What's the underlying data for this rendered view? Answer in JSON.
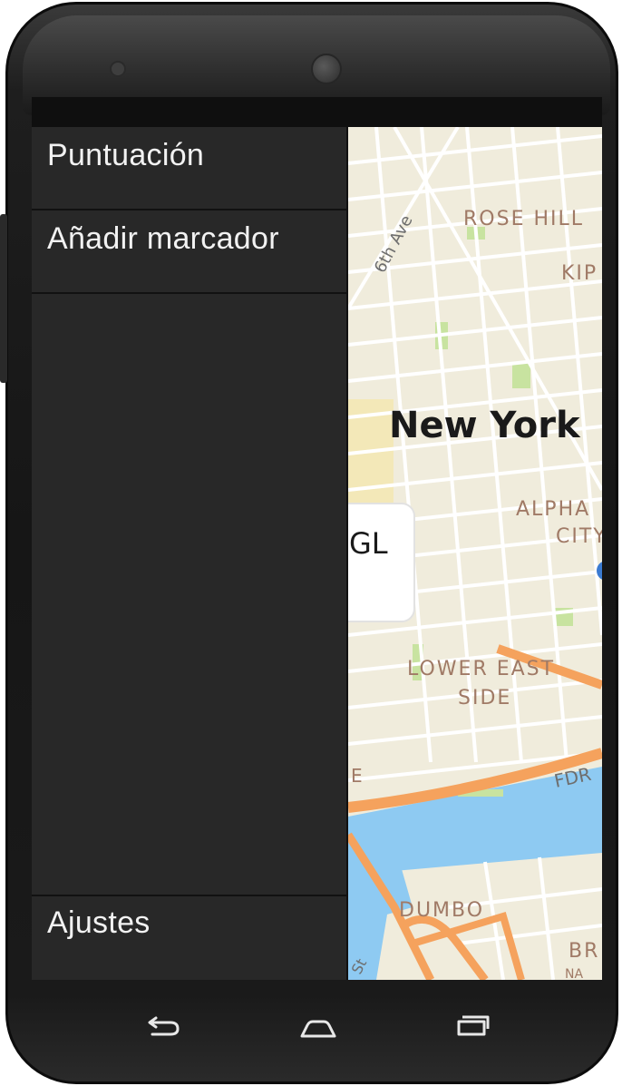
{
  "drawer": {
    "items": [
      {
        "label": "Puntuación"
      },
      {
        "label": "Añadir marcador"
      }
    ],
    "bottom_item": {
      "label": "Ajustes"
    }
  },
  "map": {
    "labels": {
      "rose_hill": "ROSE HILL",
      "kip": "KIP",
      "sixth_ave": "6th Ave",
      "new_york": "New York",
      "alpha": "ALPHA",
      "city": "CITY",
      "lower_east": "LOWER EAST",
      "side": "SIDE",
      "fdr": "FDR",
      "dumbo": "DUMBO",
      "br": "BR",
      "st": "St",
      "na": "NA",
      "e": "E"
    },
    "popup_text": "GL"
  },
  "colors": {
    "drawer_bg": "#282828",
    "map_land": "#f0ecdc",
    "water": "#8ecaf2",
    "highway": "#f5a25d",
    "park": "#c8e3a0"
  },
  "navbar": {
    "icons": [
      "back-icon",
      "home-icon",
      "recents-icon"
    ]
  }
}
